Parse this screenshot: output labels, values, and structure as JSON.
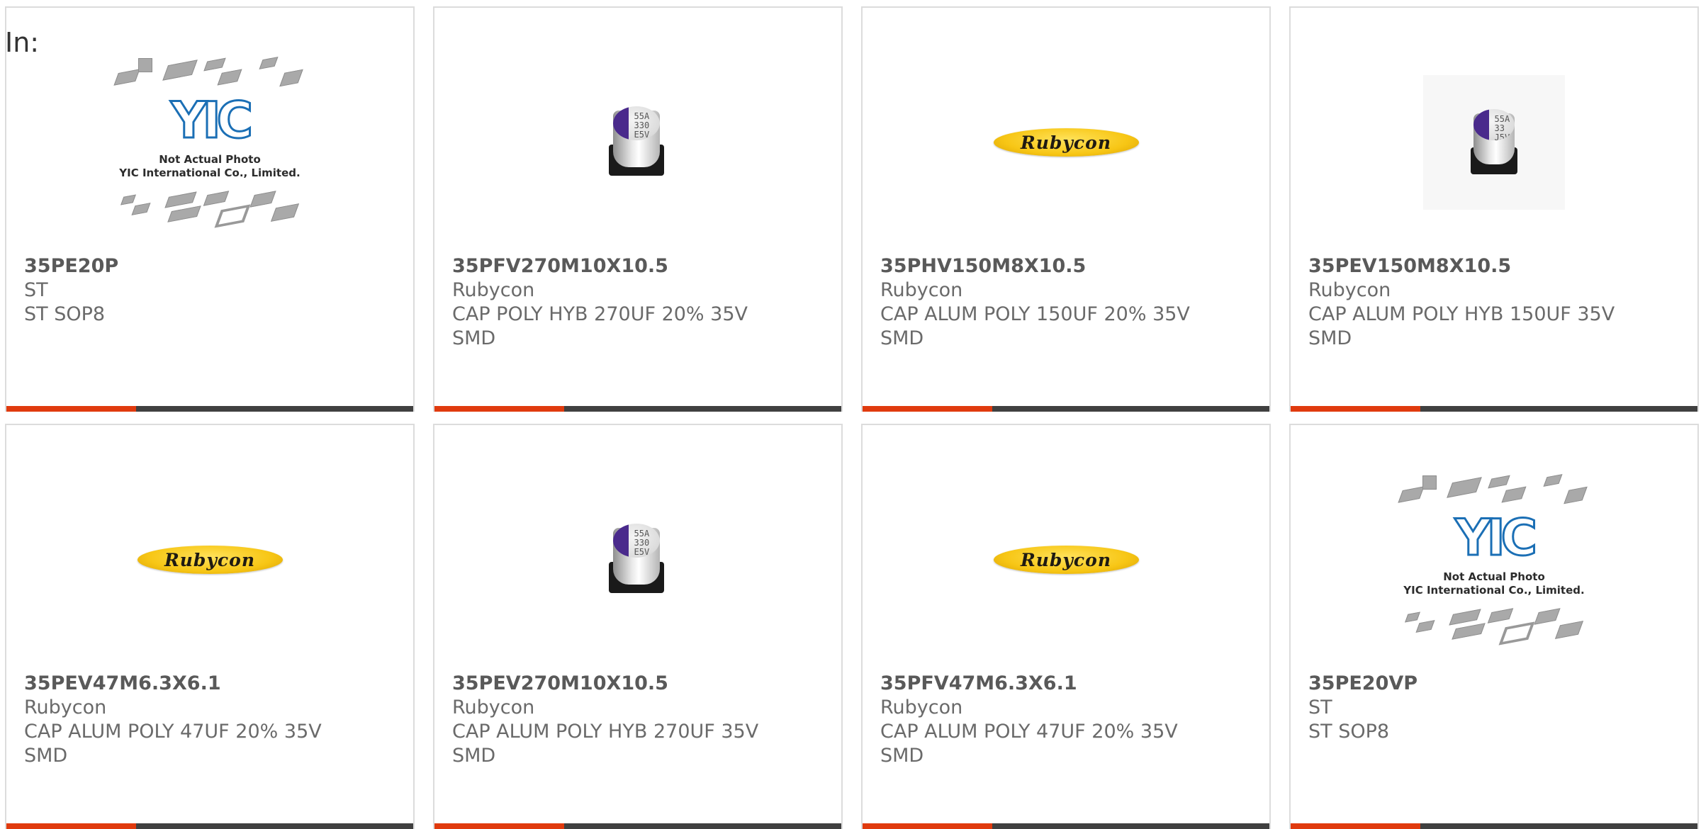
{
  "header": {
    "label": "In:"
  },
  "cards": [
    {
      "part_number": "35PE20P",
      "manufacturer": "ST",
      "description": "ST SOP8",
      "image": "placeholder-photo"
    },
    {
      "part_number": "35PFV270M10X10.5",
      "manufacturer": "Rubycon",
      "description": "CAP POLY HYB 270UF 20% 35V SMD",
      "image": "capacitor-photo"
    },
    {
      "part_number": "35PHV150M8X10.5",
      "manufacturer": "Rubycon",
      "description": "CAP ALUM POLY 150UF 20% 35V SMD",
      "image": "rubycon-logo"
    },
    {
      "part_number": "35PEV150M8X10.5",
      "manufacturer": "Rubycon",
      "description": "CAP ALUM POLY HYB 150UF 35V SMD",
      "image": "capacitor-photo-small"
    },
    {
      "part_number": "35PEV47M6.3X6.1",
      "manufacturer": "Rubycon",
      "description": "CAP ALUM POLY 47UF 20% 35V SMD",
      "image": "rubycon-logo"
    },
    {
      "part_number": "35PEV270M10X10.5",
      "manufacturer": "Rubycon",
      "description": "CAP ALUM POLY HYB 270UF 35V SMD",
      "image": "capacitor-photo"
    },
    {
      "part_number": "35PFV47M6.3X6.1",
      "manufacturer": "Rubycon",
      "description": "CAP ALUM POLY 47UF 20% 35V SMD",
      "image": "rubycon-logo"
    },
    {
      "part_number": "35PE20VP",
      "manufacturer": "ST",
      "description": "ST SOP8",
      "image": "placeholder-photo"
    }
  ],
  "images": {
    "placeholder_note_line1": "Not Actual Photo",
    "placeholder_note_line2": "YIC International Co., Limited.",
    "placeholder_logo_text": "YIC",
    "rubycon_logo_text": "Rubycon",
    "cap_marking_a": [
      "55A",
      "330",
      "E5V"
    ],
    "cap_marking_b": [
      "55A",
      "33",
      "J5V"
    ]
  },
  "colors": {
    "accent": "#e03a0e",
    "bar": "#404040",
    "border": "#dcdcdc",
    "part_number_text": "#595959",
    "body_text": "#6a6a6a"
  }
}
